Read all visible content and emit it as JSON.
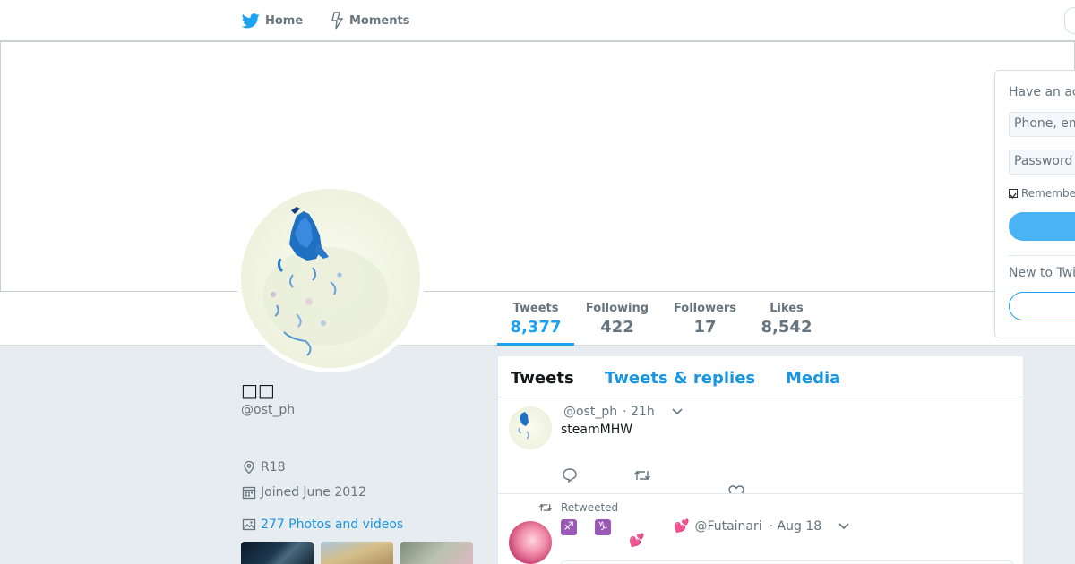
{
  "nav": {
    "home_label": "Home",
    "moments_label": "Moments",
    "home_icon": "twitter-bird-icon",
    "moments_icon": "lightning-icon"
  },
  "colors": {
    "accent": "#1da1f2",
    "link": "#1b95e0",
    "background": "#e6ecf0",
    "muted_text": "#66757f"
  },
  "stats": {
    "tweets": {
      "label": "Tweets",
      "value": "8,377"
    },
    "following": {
      "label": "Following",
      "value": "422"
    },
    "followers": {
      "label": "Followers",
      "value": "17"
    },
    "likes": {
      "label": "Likes",
      "value": "8,542"
    }
  },
  "login": {
    "title": "Have an ac",
    "phone_placeholder": "Phone, em",
    "password_placeholder": "Password",
    "remember_label": "Remembe",
    "new_label": "New to Twi"
  },
  "profile": {
    "name": "□□",
    "handle": "@ost_ph",
    "location": "R18",
    "joined": "Joined June 2012",
    "photos_link": "277 Photos and videos"
  },
  "timeline": {
    "tabs": [
      {
        "label": "Tweets"
      },
      {
        "label": "Tweets & replies"
      },
      {
        "label": "Media"
      }
    ],
    "tweets": [
      {
        "handle": "@ost_ph",
        "time": "· 21h",
        "text": "steamMHW"
      },
      {
        "retweet_label": "Retweeted",
        "emoji1": "♐",
        "emoji2": "♑",
        "heart_emoji": "💕",
        "handle": "@Futainari",
        "time": "· Aug 18"
      }
    ]
  }
}
